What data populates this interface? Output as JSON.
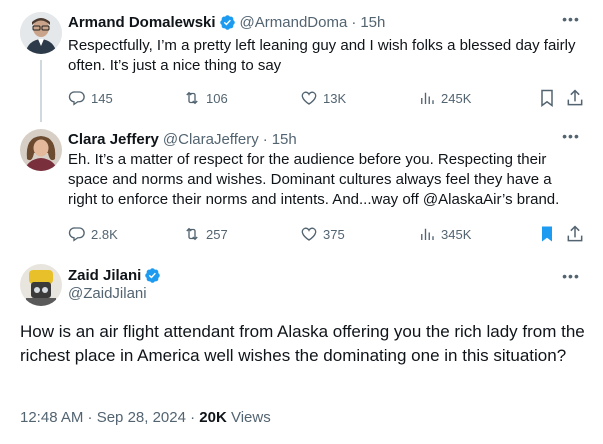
{
  "tweets": [
    {
      "name": "Armand Domalewski",
      "handle": "@ArmandDoma",
      "time": "15h",
      "text": "Respectfully, I’m a pretty left leaning guy and I wish folks a blessed day fairly often. It’s just a nice thing to say",
      "replies": "145",
      "retweets": "106",
      "likes": "13K",
      "views": "245K",
      "verified": true,
      "bookmarked": false
    },
    {
      "name": "Clara Jeffery",
      "handle": "@ClaraJeffery",
      "time": "15h",
      "text": "Eh. It’s a matter of respect for the audience before you. Respecting their space and norms and wishes. Dominant cultures always feel they have a right to enforce their norms and intents. And...way off @AlaskaAir’s brand.",
      "replies": "2.8K",
      "retweets": "257",
      "likes": "375",
      "views": "345K",
      "verified": false,
      "bookmarked": true
    }
  ],
  "main": {
    "name": "Zaid Jilani",
    "handle": "@ZaidJilani",
    "text": "How is an air flight attendant from Alaska offering you the rich lady from the richest place in America well wishes the dominating one in this situation?",
    "timestamp": "12:48 AM · Sep 28, 2024 · ",
    "views_count": "20K",
    "views_label": " Views",
    "verified": true
  },
  "colors": {
    "accent": "#1d9bf0",
    "secondary_text": "#536471",
    "thread_line": "#cfd9de"
  }
}
